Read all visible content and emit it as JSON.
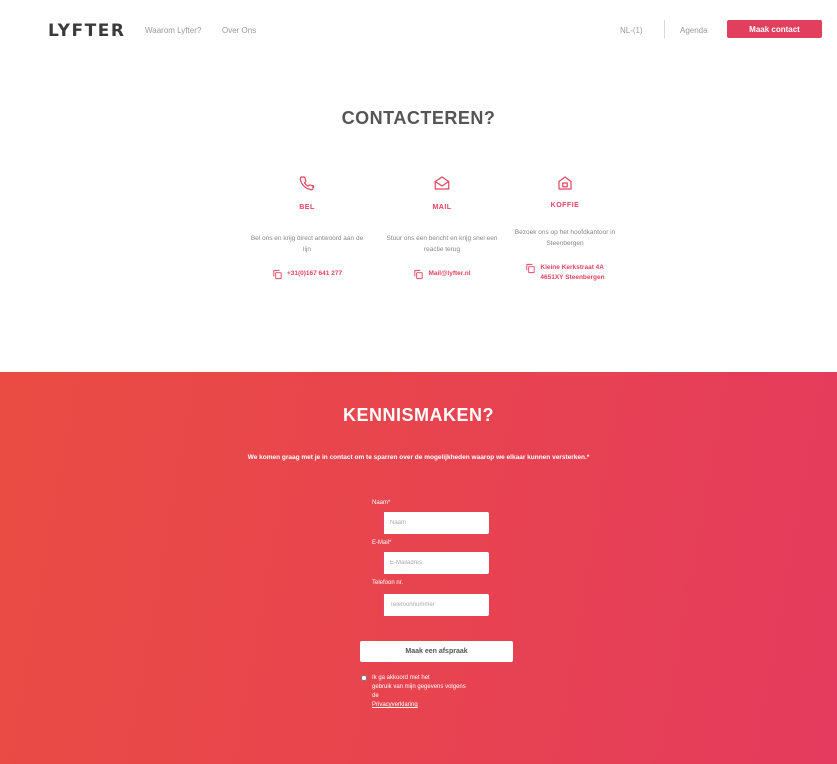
{
  "header": {
    "logo": "LYFTER",
    "nav": [
      "Waarom Lyfter?",
      "Over Ons"
    ],
    "language": "NL-(1)",
    "agenda": "Agenda",
    "cta": "Maak contact"
  },
  "contact": {
    "title": "CONTACTEREN?",
    "columns": [
      {
        "icon": "phone-icon",
        "label": "BEL",
        "desc": "Bel ons en krijg direct antwoord aan de lijn",
        "link": "+31(0)167 641 277"
      },
      {
        "icon": "mail-icon",
        "label": "MAIL",
        "desc": "Stuur ons een bericht en krijg snel een reactie terug",
        "link": "Mail@lyfter.nl"
      },
      {
        "icon": "home-icon",
        "label": "KOFFIE",
        "desc": "Bezoek ons op het hoofdkantoor in Steenbergen",
        "link_line1": "Kleine Kerkstraat 4A",
        "link_line2": "4651XY Steenbergen"
      }
    ]
  },
  "kennismaken": {
    "title": "KENNISMAKEN?",
    "subtitle": "We komen graag met je in contact om te sparren over de mogelijkheden waarop we elkaar kunnen versterken.*",
    "form": {
      "name_label": "Naam*",
      "name_placeholder": "Naam",
      "email_label": "E-Mail*",
      "email_placeholder": "E-Mailadres",
      "phone_label": "Telefoon nr.",
      "phone_placeholder": "Telefoonnummer",
      "submit": "Maak een afspraak",
      "consent_line1": "Ik ga akkoord met het",
      "consent_line2": "gebruik van mijn gegevens",
      "consent_line3": "volgens de",
      "consent_link": "Privacyverklaring"
    }
  },
  "colors": {
    "accent": "#e8435f",
    "gradient_start": "#ea4c43",
    "gradient_end": "#e53b5e"
  }
}
